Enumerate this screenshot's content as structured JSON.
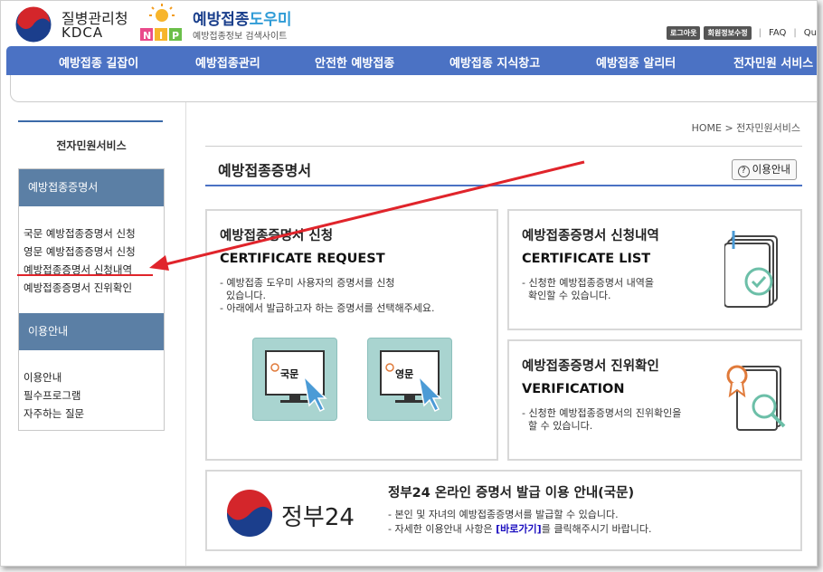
{
  "header": {
    "kdca_name_ko": "질병관리청",
    "kdca_name_en": "KDCA",
    "site_title_prefix": "예방접종",
    "site_title_accent": "도우미",
    "site_subtitle": "예방접종정보 검색사이트",
    "nip_label": "NIP",
    "top_links": {
      "logout": "로그아웃",
      "member_edit": "회원정보수정",
      "faq": "FAQ",
      "more": "Qu"
    }
  },
  "gnb": [
    "예방접종 길잡이",
    "예방접종관리",
    "안전한 예방접종",
    "예방접종 지식창고",
    "예방접종 알리터",
    "전자민원 서비스"
  ],
  "sidebar": {
    "title": "전자민원서비스",
    "section1": "예방접종증명서",
    "items1": [
      "국문 예방접종증명서 신청",
      "영문 예방접종증명서 신청",
      "예방접종증명서 신청내역",
      "예방접종증명서 진위확인"
    ],
    "section2": "이용안내",
    "items2": [
      "이용안내",
      "필수프로그램",
      "자주하는 질문"
    ]
  },
  "breadcrumb": "HOME > 전자민원서비스",
  "page": {
    "title": "예방접종증명서",
    "guide_button": "이용안내",
    "guide_icon": "?"
  },
  "cards": {
    "request": {
      "title": "예방접종증명서 신청",
      "title_en": "CERTIFICATE REQUEST",
      "desc1": "- 예방접종 도우미 사용자의 증명서를 신청",
      "desc1b": "  있습니다.",
      "desc2": "- 아래에서 발급하고자 하는 증명서를 선택해주세요.",
      "btn_ko": "국문",
      "btn_en": "영문"
    },
    "list": {
      "title": "예방접종증명서 신청내역",
      "title_en": "CERTIFICATE LIST",
      "desc1": "- 신청한 예방접종증명서 내역을",
      "desc1b": "  확인할 수 있습니다."
    },
    "verify": {
      "title": "예방접종증명서 진위확인",
      "title_en": "VERIFICATION",
      "desc1": "- 신청한 예방접종증명서의 진위확인을",
      "desc1b": "  할 수 있습니다."
    },
    "gov24": {
      "logo_text": "정부24",
      "title": "정부24 온라인 증명서 발급 이용 안내(국문)",
      "desc1": "- 본인 및 자녀의 예방접종증명서를 발급할 수 있습니다.",
      "desc2_pre": "- 자세한 이용안내 사항은 ",
      "desc2_link": "[바로가기]",
      "desc2_post": "를 클릭해주시기 바랍니다."
    }
  },
  "colors": {
    "nav_bg": "#4b72c4",
    "sidebar_head": "#5b7fa5",
    "cert_btn": "#a9d4d0",
    "arrow": "#e0242b"
  }
}
